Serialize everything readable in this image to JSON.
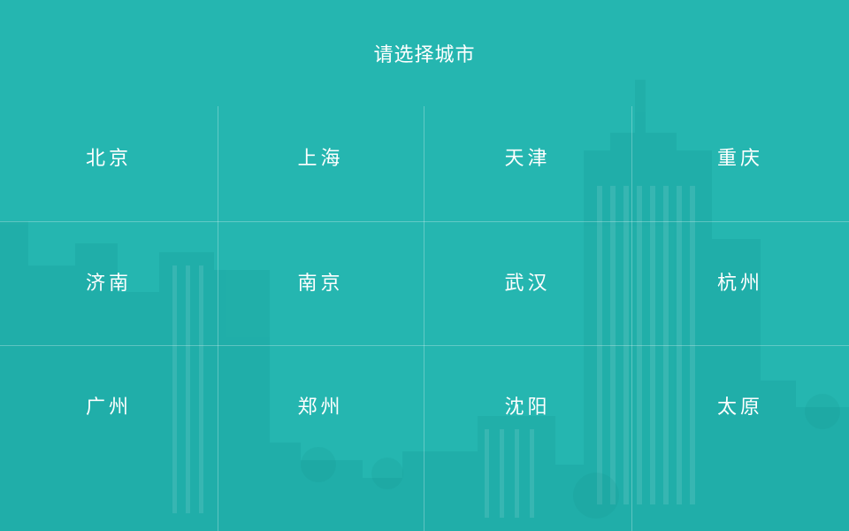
{
  "header": {
    "title": "请选择城市"
  },
  "cities": [
    "北京",
    "上海",
    "天津",
    "重庆",
    "济南",
    "南京",
    "武汉",
    "杭州",
    "广州",
    "郑州",
    "沈阳",
    "太原"
  ],
  "colors": {
    "background": "#22b8b0",
    "text": "#ffffff",
    "grid": "rgba(255,255,255,0.28)"
  }
}
